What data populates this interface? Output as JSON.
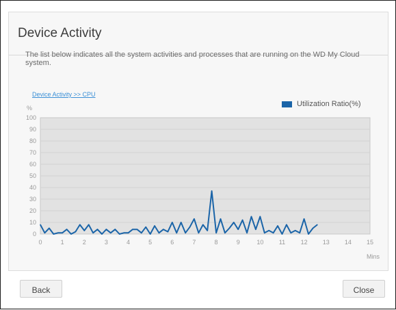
{
  "dialog": {
    "title": "Device Activity",
    "description": "The list below indicates all the system activities and processes that are running on the WD My Cloud system.",
    "breadcrumb": "Device Activity >> CPU",
    "back_label": "Back",
    "close_label": "Close"
  },
  "colors": {
    "accent": "#1a64a8",
    "link": "#3a8fd6",
    "plot_bg": "#e2e2e2"
  },
  "chart_data": {
    "type": "line",
    "ylabel": "%",
    "xlabel": "Mins",
    "ylim": [
      0,
      100
    ],
    "xlim": [
      0,
      15
    ],
    "yticks": [
      0,
      10,
      20,
      30,
      40,
      50,
      60,
      70,
      80,
      90,
      100
    ],
    "xticks": [
      0,
      1,
      2,
      3,
      4,
      5,
      6,
      7,
      8,
      9,
      10,
      11,
      12,
      13,
      14,
      15
    ],
    "grid": true,
    "legend_position": "top-right",
    "series": [
      {
        "name": "Utilization Ratio(%)",
        "color": "#1a64a8",
        "x": [
          0,
          0.2,
          0.4,
          0.6,
          0.8,
          1,
          1.2,
          1.4,
          1.6,
          1.8,
          2,
          2.2,
          2.4,
          2.6,
          2.8,
          3,
          3.2,
          3.4,
          3.6,
          3.8,
          4,
          4.2,
          4.4,
          4.6,
          4.8,
          5,
          5.2,
          5.4,
          5.6,
          5.8,
          6,
          6.2,
          6.4,
          6.6,
          6.8,
          7,
          7.2,
          7.4,
          7.6,
          7.8,
          8,
          8.2,
          8.4,
          8.6,
          8.8,
          9,
          9.2,
          9.4,
          9.6,
          9.8,
          10,
          10.2,
          10.4,
          10.6,
          10.8,
          11,
          11.2,
          11.4,
          11.6,
          11.8,
          12,
          12.2,
          12.4,
          12.6
        ],
        "values": [
          8,
          1,
          5,
          0,
          1,
          1,
          4,
          0,
          2,
          8,
          3,
          8,
          1,
          4,
          0,
          4,
          1,
          4,
          0,
          1,
          1,
          4,
          4,
          1,
          6,
          0,
          7,
          1,
          4,
          2,
          10,
          1,
          10,
          1,
          6,
          13,
          1,
          8,
          3,
          37,
          1,
          13,
          1,
          5,
          10,
          4,
          12,
          1,
          15,
          4,
          15,
          1,
          3,
          1,
          7,
          0,
          8,
          1,
          3,
          1,
          13,
          0,
          5,
          8
        ]
      }
    ]
  }
}
